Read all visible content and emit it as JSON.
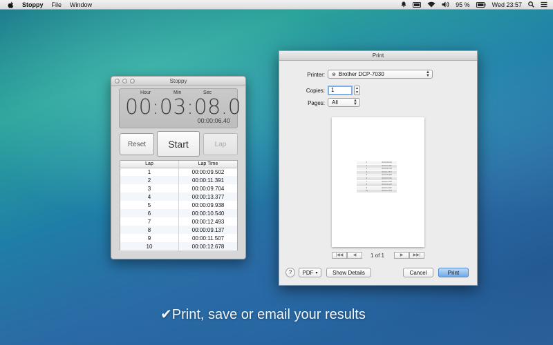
{
  "menubar": {
    "app_name": "Stoppy",
    "menus": [
      "File",
      "Window"
    ],
    "battery_percent": "95 %",
    "clock": "Wed 23:57",
    "status_icons": [
      "notification-icon",
      "display-icon",
      "wifi-icon",
      "volume-icon",
      "battery-icon",
      "search-icon",
      "list-icon"
    ]
  },
  "stoppy": {
    "title": "Stoppy",
    "units": {
      "hour": "Hour",
      "min": "Min",
      "sec": "Sec"
    },
    "main_time": "00:03:08.0",
    "lap_time": "00:00:06.40",
    "buttons": {
      "reset": "Reset",
      "start": "Start",
      "lap": "Lap"
    },
    "columns": {
      "lap": "Lap",
      "lap_time": "Lap Time"
    },
    "laps": [
      {
        "lap": "1",
        "time": "00:00:09.502"
      },
      {
        "lap": "2",
        "time": "00:00:11.391"
      },
      {
        "lap": "3",
        "time": "00:00:09.704"
      },
      {
        "lap": "4",
        "time": "00:00:13.377"
      },
      {
        "lap": "5",
        "time": "00:00:09.938"
      },
      {
        "lap": "6",
        "time": "00:00:10.540"
      },
      {
        "lap": "7",
        "time": "00:00:12.493"
      },
      {
        "lap": "8",
        "time": "00:00:09.137"
      },
      {
        "lap": "9",
        "time": "00:00:11.507"
      },
      {
        "lap": "10",
        "time": "00:00:12.678"
      }
    ]
  },
  "print": {
    "title": "Print",
    "printer_label": "Printer:",
    "printer_value": "Brother DCP-7030",
    "copies_label": "Copies:",
    "copies_value": "1",
    "pages_label": "Pages:",
    "pages_value": "All",
    "page_count": "1 of 1",
    "pdf_label": "PDF",
    "show_details": "Show Details",
    "cancel": "Cancel",
    "print": "Print",
    "help": "?"
  },
  "caption": "Print, save or email your results",
  "colors": {
    "accent": "#6fa8e8",
    "caption": "#f3f6f9"
  }
}
